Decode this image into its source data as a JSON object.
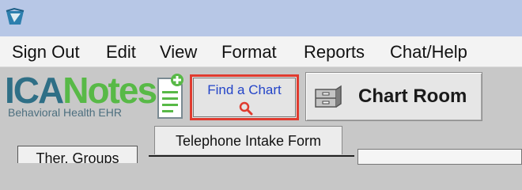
{
  "menu": {
    "items": [
      "Sign Out",
      "Edit",
      "View",
      "Format",
      "Reports",
      "Chat/Help"
    ]
  },
  "logo": {
    "part1": "ICA",
    "part2": "Notes",
    "subtitle": "Behavioral Health EHR"
  },
  "toolbar": {
    "find_chart_label": "Find a Chart",
    "chart_room_label": "Chart Room"
  },
  "tabs": {
    "telephone_intake": "Telephone Intake Form",
    "ther_groups": "Ther. Groups"
  },
  "colors": {
    "titlebar": "#b7c7e6",
    "menubar": "#f3f3f3",
    "toolbar": "#c8c8c8",
    "highlight": "#e03b2f",
    "link_blue": "#2445c8",
    "logo_blue": "#2f6f86",
    "logo_green": "#58b947"
  },
  "icons": {
    "app": "app-icon",
    "search": "search-icon",
    "cabinet": "file-cabinet-icon",
    "document": "document-icon"
  }
}
